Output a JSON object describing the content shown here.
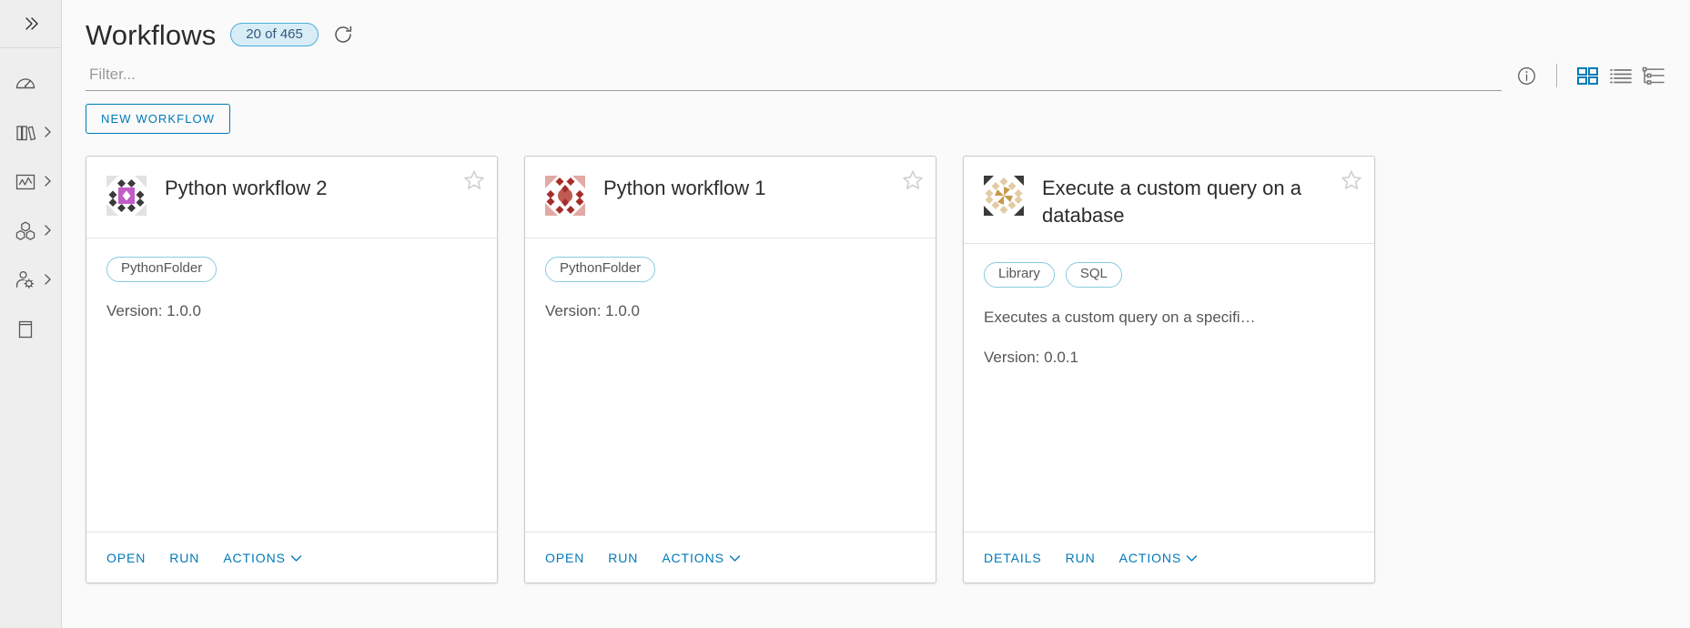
{
  "sidebar": {
    "collapse_icon": "chevron-double-right-icon",
    "items": [
      {
        "icon": "dashboard-gauge-icon",
        "name": "dashboard",
        "has_caret": false
      },
      {
        "icon": "library-books-icon",
        "name": "library",
        "has_caret": true
      },
      {
        "icon": "chart-activity-icon",
        "name": "analytics",
        "has_caret": true
      },
      {
        "icon": "cubes-packages-icon",
        "name": "content",
        "has_caret": true
      },
      {
        "icon": "user-gear-icon",
        "name": "administration",
        "has_caret": true
      },
      {
        "icon": "book-card-icon",
        "name": "catalog",
        "has_caret": false
      }
    ]
  },
  "header": {
    "title": "Workflows",
    "count_badge": "20 of 465",
    "refresh_icon": "refresh-icon",
    "info_icon": "info-circle-icon",
    "accent_color": "#0079b8",
    "badge_bg": "#d9edf7",
    "badge_border": "#49afd9"
  },
  "filter": {
    "placeholder": "Filter...",
    "value": ""
  },
  "view_toggle": {
    "options": [
      {
        "name": "grid-view",
        "icon": "grid-view-icon",
        "selected": true
      },
      {
        "name": "list-view",
        "icon": "list-view-icon",
        "selected": false
      },
      {
        "name": "tree-view",
        "icon": "tree-view-icon",
        "selected": false
      }
    ]
  },
  "toolbar": {
    "new_workflow_label": "NEW WORKFLOW"
  },
  "cards": [
    {
      "title": "Python workflow 2",
      "identicon": "identicon-purple",
      "chips": [
        "PythonFolder"
      ],
      "description": "",
      "version": "Version: 1.0.0",
      "favorite": false,
      "star_icon": "star-outline-icon",
      "actions": [
        {
          "label": "OPEN",
          "name": "open-action",
          "caret": false
        },
        {
          "label": "RUN",
          "name": "run-action",
          "caret": false
        },
        {
          "label": "ACTIONS",
          "name": "actions-menu",
          "caret": true
        }
      ]
    },
    {
      "title": "Python workflow 1",
      "identicon": "identicon-red",
      "chips": [
        "PythonFolder"
      ],
      "description": "",
      "version": "Version: 1.0.0",
      "favorite": false,
      "star_icon": "star-outline-icon",
      "actions": [
        {
          "label": "OPEN",
          "name": "open-action",
          "caret": false
        },
        {
          "label": "RUN",
          "name": "run-action",
          "caret": false
        },
        {
          "label": "ACTIONS",
          "name": "actions-menu",
          "caret": true
        }
      ]
    },
    {
      "title": "Execute a custom query on a database",
      "identicon": "identicon-tan",
      "chips": [
        "Library",
        "SQL"
      ],
      "description": "Executes a custom query on a specifi…",
      "version": "Version: 0.0.1",
      "favorite": false,
      "star_icon": "star-outline-icon",
      "actions": [
        {
          "label": "DETAILS",
          "name": "details-action",
          "caret": false
        },
        {
          "label": "RUN",
          "name": "run-action",
          "caret": false
        },
        {
          "label": "ACTIONS",
          "name": "actions-menu",
          "caret": true
        }
      ]
    }
  ]
}
